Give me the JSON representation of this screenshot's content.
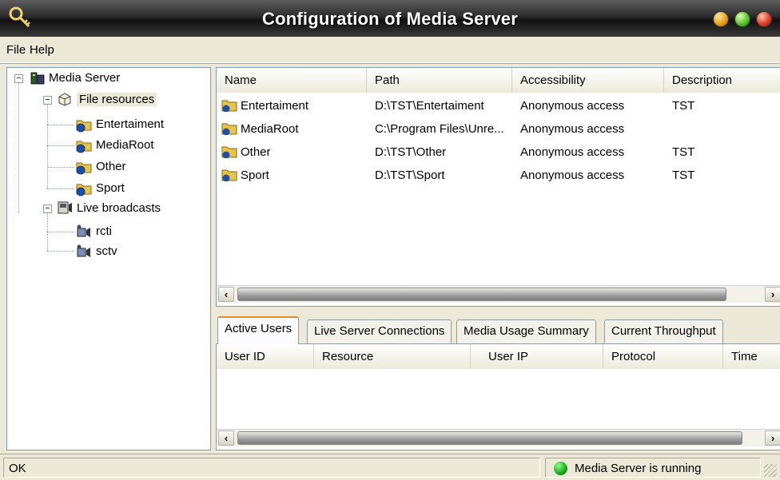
{
  "window": {
    "title": "Configuration of Media Server",
    "app_icon": "key-icon",
    "buttons": [
      "minimize",
      "maximize",
      "close"
    ]
  },
  "menu": {
    "file": "File",
    "help": "Help"
  },
  "tree": {
    "root": "Media Server",
    "file_resources": {
      "label": "File resources",
      "children": [
        "Entertaiment",
        "MediaRoot",
        "Other",
        "Sport"
      ]
    },
    "live_broadcasts": {
      "label": "Live broadcasts",
      "children": [
        "rcti",
        "sctv"
      ]
    }
  },
  "resources": {
    "columns": [
      "Name",
      "Path",
      "Accessibility",
      "Description"
    ],
    "rows": [
      {
        "name": "Entertaiment",
        "path": "D:\\TST\\Entertaiment",
        "access": "Anonymous access",
        "description": "TST"
      },
      {
        "name": "MediaRoot",
        "path": "C:\\Program Files\\Unre...",
        "access": "Anonymous access",
        "description": ""
      },
      {
        "name": "Other",
        "path": "D:\\TST\\Other",
        "access": "Anonymous access",
        "description": "TST"
      },
      {
        "name": "Sport",
        "path": "D:\\TST\\Sport",
        "access": "Anonymous access",
        "description": "TST"
      }
    ]
  },
  "tabs": [
    "Active Users",
    "Live Server Connections",
    "Media Usage Summary",
    "Current Throughput"
  ],
  "active_tab": "Active Users",
  "users": {
    "columns": [
      "User ID",
      "Resource",
      "User IP",
      "Protocol",
      "Time"
    ]
  },
  "status": {
    "left": "OK",
    "right": "Media Server is running",
    "indicator_color": "#1aa51a"
  },
  "colors": {
    "titlebar": "#2b2b2b",
    "active_tab_accent": "#e68b2c",
    "window_bg": "#ECE9D8"
  }
}
